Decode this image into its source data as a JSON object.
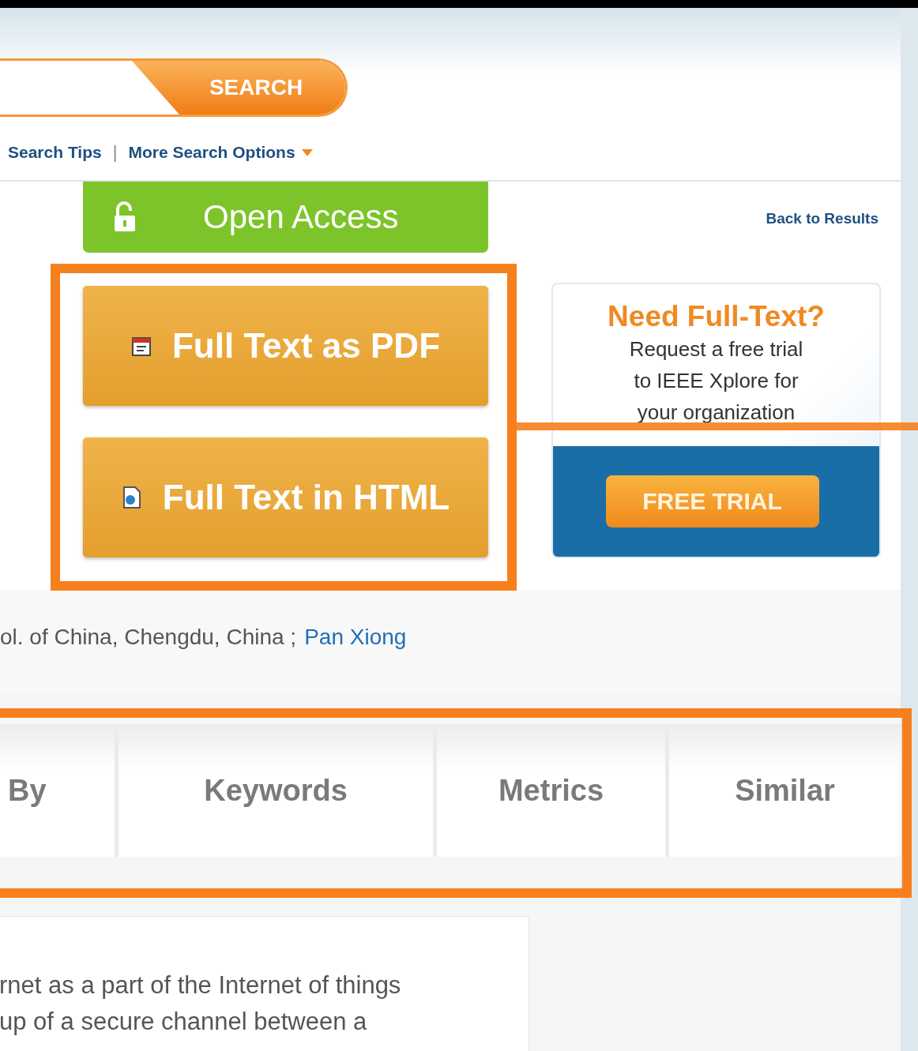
{
  "search": {
    "button": "SEARCH"
  },
  "search_links": [
    {
      "label": "Search Tips"
    },
    {
      "label": "More Search Options",
      "dropdown": true
    }
  ],
  "search_links_separator": "|",
  "open_access": {
    "label": "Open Access"
  },
  "back_link": "Back to Results",
  "fulltext_buttons": [
    {
      "kind": "pdf",
      "label": "Full Text as PDF"
    },
    {
      "kind": "html",
      "label": "Full Text in HTML"
    }
  ],
  "trial_promo": {
    "title": "Need Full-Text?",
    "lines": [
      "Request a free trial",
      "to IEEE Xplore for",
      "your organization"
    ],
    "button": "FREE TRIAL"
  },
  "affiliation": {
    "text": "ol. of China, Chengdu, China ;",
    "author_link": "Pan Xiong"
  },
  "tabs": [
    {
      "label": "By"
    },
    {
      "label": "Keywords"
    },
    {
      "label": "Metrics"
    },
    {
      "label": "Similar"
    }
  ],
  "abstract": {
    "lines": [
      "rnet as a part of the Internet of things",
      "up of a secure channel between a"
    ]
  }
}
